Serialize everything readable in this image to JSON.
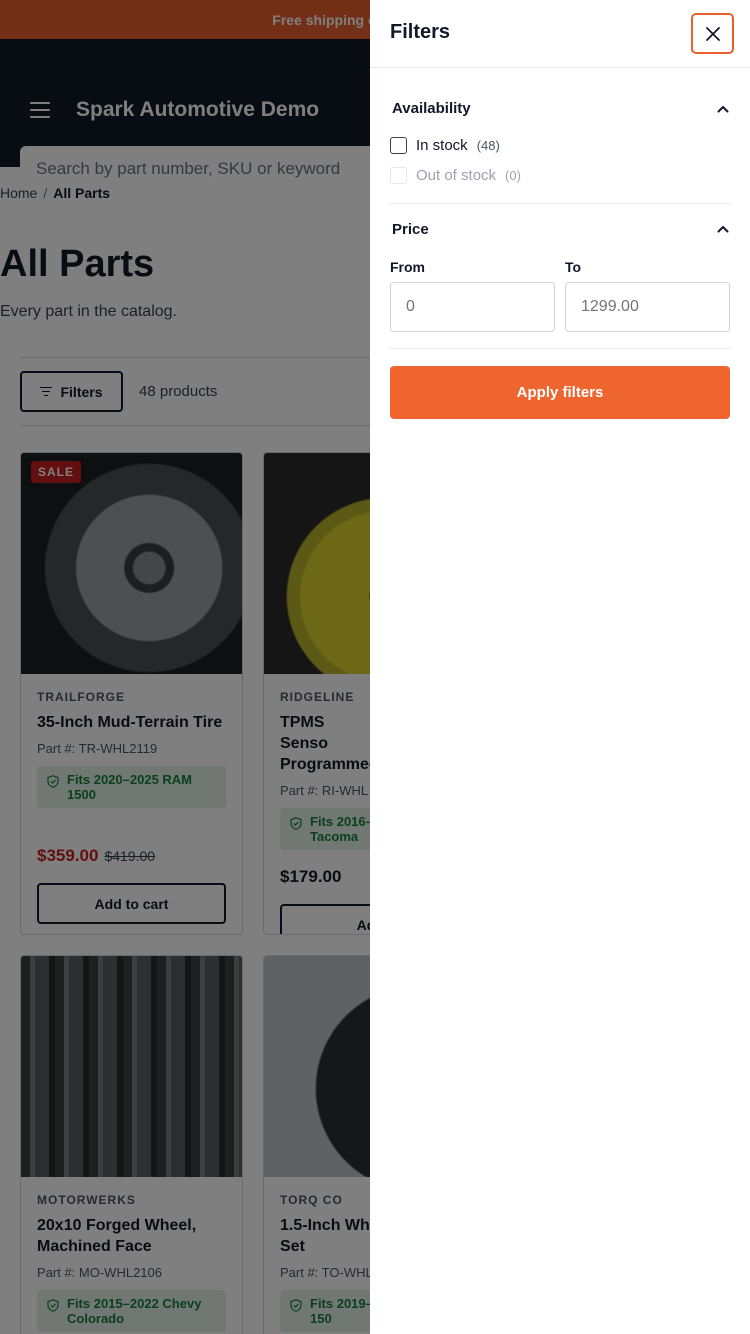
{
  "announcement": "Free shipping on orders over $",
  "header": {
    "site_title": "Spark Automotive Demo",
    "search_placeholder": "Search by part number, SKU or keyword"
  },
  "breadcrumb": {
    "home": "Home",
    "separator": "/",
    "current": "All Parts"
  },
  "page": {
    "title": "All Parts",
    "subtitle": "Every part in the catalog."
  },
  "toolbar": {
    "filters_label": "Filters",
    "product_count": "48 products"
  },
  "products": [
    {
      "badge": "SALE",
      "brand": "TRAILFORGE",
      "name": "35-Inch Mud-Terrain Tire",
      "part": "Part #: TR-WHL2119",
      "fits": "Fits 2020–2025 RAM 1500",
      "price": "$359.00",
      "old_price": "$419.00",
      "cart": "Add to cart"
    },
    {
      "brand": "RIDGELINE",
      "name": "TPMS Senso Programmed",
      "part": "Part #: RI-WHL",
      "fits": "Fits 2016– Tacoma",
      "price": "$179.00",
      "cart": "Add t"
    },
    {
      "brand": "MOTORWERKS",
      "name": "20x10 Forged Wheel, Machined Face",
      "part": "Part #: MO-WHL2106",
      "fits": "Fits 2015–2022 Chevy Colorado"
    },
    {
      "brand": "TORQ CO",
      "name": "1.5-Inch Wh Set",
      "part": "Part #: TO-WHL",
      "fits": "Fits 2019– 150"
    }
  ],
  "drawer": {
    "title": "Filters",
    "availability": {
      "heading": "Availability",
      "options": [
        {
          "label": "In stock",
          "count": "(48)",
          "enabled": true
        },
        {
          "label": "Out of stock",
          "count": "(0)",
          "enabled": false
        }
      ]
    },
    "price": {
      "heading": "Price",
      "from_label": "From",
      "to_label": "To",
      "from_placeholder": "0",
      "to_placeholder": "1299.00"
    },
    "apply_label": "Apply filters"
  },
  "colors": {
    "accent": "#e8612c",
    "header": "#111827",
    "sale": "#c81e1e",
    "fits_bg": "#e3efe6",
    "fits_text": "#15803d"
  },
  "icons": {
    "menu": "hamburger-icon",
    "filter": "filter-lines-icon",
    "close": "close-icon",
    "chevron": "chevron-up-icon",
    "fits": "shield-check-icon"
  }
}
